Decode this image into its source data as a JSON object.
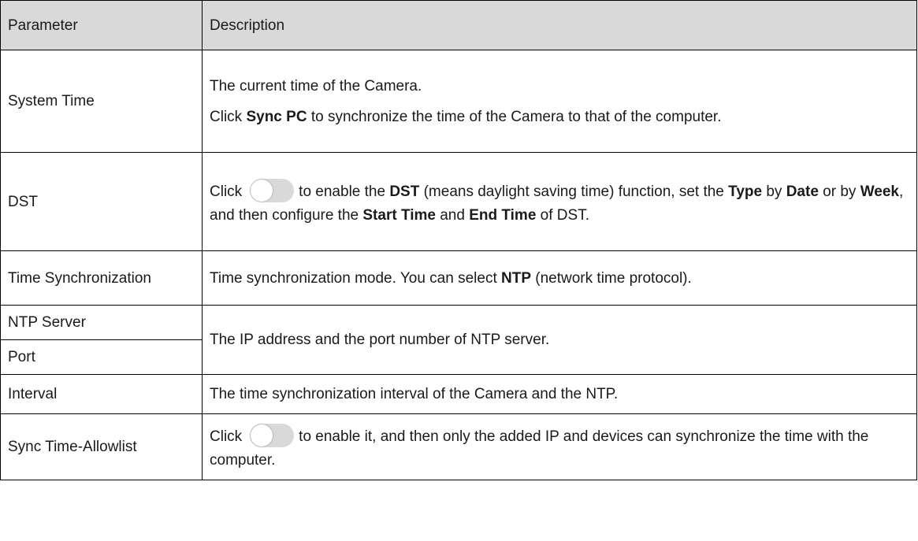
{
  "header": {
    "parameter": "Parameter",
    "description": "Description"
  },
  "rows": {
    "system_time": {
      "param": "System Time",
      "d1": "The current time of the Camera.",
      "d2_a": "Click ",
      "d2_b": "Sync PC",
      "d2_c": "  to synchronize the time of the Camera to that of the computer."
    },
    "dst": {
      "param": "DST",
      "a": "Click",
      "toggle": "toggle-switch-icon",
      "b": "to enable the ",
      "c": "DST",
      "d": "  (means daylight saving time) function, set the ",
      "e": "Type",
      "f": " by ",
      "g": "Date",
      "h": " or by ",
      "i": "Week",
      "j": ", and then configure the ",
      "k": "Start Time",
      "l": " and ",
      "m": "End Time",
      "n": " of DST."
    },
    "time_sync": {
      "param": "Time Synchronization",
      "a": "Time synchronization mode. You can select ",
      "b": "NTP",
      "c": "  (network time protocol)."
    },
    "ntp_server": {
      "param": "NTP Server"
    },
    "port": {
      "param": "Port",
      "desc": "The IP address and the port number of NTP server."
    },
    "interval": {
      "param": "Interval",
      "desc": "The time synchronization interval of the Camera and the NTP."
    },
    "allowlist": {
      "param": "Sync Time-Allowlist",
      "a": "Click",
      "toggle": "toggle-switch-icon",
      "b": "to enable it, and then only the added IP and devices can synchronize the time with the computer."
    }
  }
}
